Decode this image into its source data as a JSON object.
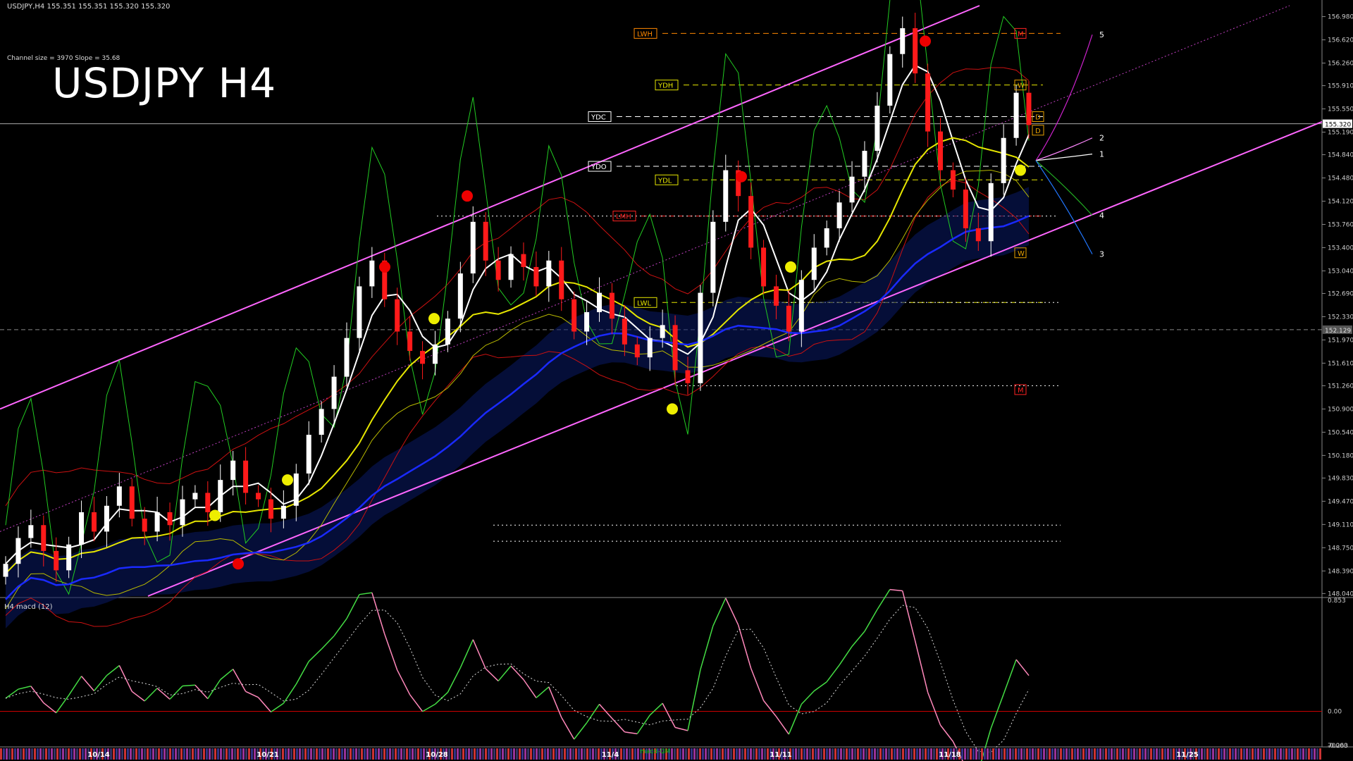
{
  "header": {
    "symbol_info": "USDJPY,H4  155.351 155.351 155.320 155.320",
    "channel_info": "Channel size = 3970 Slope = 35.68",
    "title": "USDJPY H4",
    "macd_label": "H4  macd (12)",
    "sub_label": "macd-GM"
  },
  "colors": {
    "background": "#000000",
    "bull_candle": "#ffffff",
    "bear_candle": "#ff1a1a",
    "channel": "#ff66ff",
    "ma_yellow": "#e6e600",
    "ma_white": "#ffffff",
    "ma_blue": "#1a2aff",
    "green_line": "#22cc22",
    "macd_up": "#44dd44",
    "macd_down": "#ff88bb",
    "zero_line": "#cc0000",
    "axis_text": "#cccccc"
  },
  "chart_data": {
    "type": "candlestick",
    "title": "USDJPY H4",
    "y_ticks": [
      "156.980",
      "156.620",
      "156.260",
      "155.910",
      "155.550",
      "155.190",
      "154.840",
      "154.480",
      "154.120",
      "153.760",
      "153.400",
      "153.040",
      "152.690",
      "152.330",
      "151.970",
      "151.610",
      "151.260",
      "150.900",
      "150.540",
      "150.180",
      "149.830",
      "149.470",
      "149.110",
      "148.750",
      "148.390",
      "148.040"
    ],
    "ylim": [
      148.0,
      157.15
    ],
    "current_price": "155.320",
    "secondary_price": "152.129",
    "x_ticks": [
      "10/14",
      "10/21",
      "10/28",
      "11/4",
      "11/11",
      "11/18",
      "11/25"
    ],
    "macd_ticks": [
      "0.853",
      "0.00",
      "-0.263",
      "70000"
    ],
    "level_labels": [
      {
        "text": "LWH",
        "price": 156.72,
        "color": "#ff8800"
      },
      {
        "text": "M",
        "price": 156.72,
        "color": "#ff2222"
      },
      {
        "text": "YDH",
        "price": 155.92,
        "color": "#e6e600"
      },
      {
        "text": "W",
        "price": 155.92,
        "color": "#e6a000"
      },
      {
        "text": "YDC",
        "price": 155.43,
        "color": "#ffffff"
      },
      {
        "text": "D",
        "price": 155.43,
        "color": "#e6a000"
      },
      {
        "text": "D",
        "price": 155.22,
        "color": "#e6a000"
      },
      {
        "text": "YDO",
        "price": 154.66,
        "color": "#ffffff"
      },
      {
        "text": "YDL",
        "price": 154.45,
        "color": "#e6e600"
      },
      {
        "text": "LMH",
        "price": 153.89,
        "color": "#ff2222"
      },
      {
        "text": "W",
        "price": 153.32,
        "color": "#e6a000"
      },
      {
        "text": "LWL",
        "price": 152.55,
        "color": "#e6e600"
      },
      {
        "text": "M",
        "price": 151.2,
        "color": "#ff2222"
      }
    ],
    "projection_labels": [
      "5",
      "2",
      "1",
      "4",
      "3"
    ],
    "series": [
      {
        "name": "close",
        "values": [
          148.5,
          148.9,
          149.1,
          148.7,
          148.4,
          148.8,
          149.3,
          149.0,
          149.4,
          149.7,
          149.2,
          149.0,
          149.3,
          149.1,
          149.5,
          149.6,
          149.3,
          149.8,
          150.1,
          149.6,
          149.5,
          149.2,
          149.4,
          149.9,
          150.5,
          150.9,
          151.4,
          152.0,
          152.8,
          153.2,
          152.6,
          152.1,
          151.8,
          151.6,
          151.9,
          152.3,
          153.0,
          153.8,
          153.2,
          152.9,
          153.3,
          153.1,
          152.8,
          153.2,
          152.6,
          152.1,
          152.4,
          152.7,
          152.3,
          151.9,
          151.7,
          152.0,
          152.2,
          151.5,
          151.3,
          152.7,
          153.8,
          154.6,
          154.2,
          153.4,
          152.8,
          152.5,
          152.1,
          152.9,
          153.4,
          153.7,
          154.1,
          154.5,
          154.9,
          155.6,
          156.4,
          156.8,
          156.1,
          155.2,
          154.6,
          154.3,
          153.7,
          153.5,
          154.4,
          155.1,
          155.8,
          155.3
        ]
      }
    ]
  }
}
